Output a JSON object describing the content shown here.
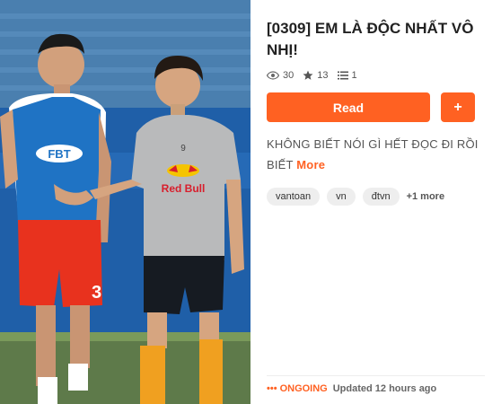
{
  "story": {
    "title": "[0309] EM LÀ ĐỘC NHẤT VÔ NHỊ!",
    "stats": {
      "views": "30",
      "votes": "13",
      "parts": "1"
    },
    "read_label": "Read",
    "add_label": "+",
    "description": "KHÔNG BIẾT NÓI GÌ HẾT ĐỌC ĐI RỒI BIẾT",
    "more_label": "More",
    "tags": [
      "vantoan",
      "vn",
      "đtvn"
    ],
    "tags_more": "+1 more",
    "status_dots": "•••",
    "status": "ONGOING",
    "updated": "Updated 12 hours ago"
  },
  "cover": {
    "jersey_left_text": "FBT",
    "jersey_right_text": "Red Bull",
    "shorts_number": "3",
    "shirt_number": "9"
  },
  "colors": {
    "accent": "#ff6122",
    "tag_bg": "#eeeeee"
  },
  "icons": {
    "views": "eye-icon",
    "votes": "star-icon",
    "parts": "list-icon",
    "status": "dots-icon"
  }
}
